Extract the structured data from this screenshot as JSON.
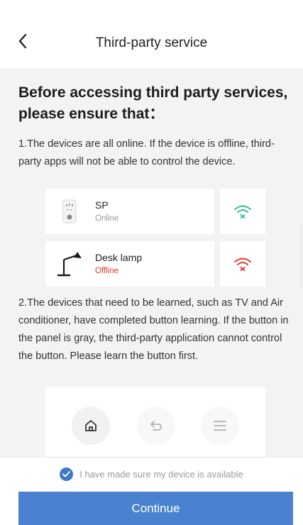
{
  "header": {
    "title": "Third-party service",
    "back_icon": "chevron-left-icon"
  },
  "content": {
    "heading": "Before accessing third party services, please ensure that：",
    "step1": "1.The devices are all online. If the device is offline, third-party apps will not be able to control the device.",
    "devices": [
      {
        "name": "SP",
        "status": "Online",
        "icon": "smart-plug-icon",
        "wifi_icon": "wifi-icon",
        "wifi_color": "#2bbf95"
      },
      {
        "name": "Desk lamp",
        "status": "Offline",
        "icon": "desk-lamp-icon",
        "wifi_icon": "wifi-off-icon",
        "wifi_color": "#e5322b"
      }
    ],
    "step2": "2.The devices that need to be learned, such as TV and Air conditioner, have completed button learning. If the button in the panel is gray, the third-party application cannot control the button. Please learn the button first.",
    "panel_buttons": [
      "home-icon",
      "return-icon",
      "menu-icon"
    ]
  },
  "footer": {
    "agree_text": "I have made sure my device is available",
    "agree_checked": true,
    "continue_label": "Continue"
  },
  "colors": {
    "accent": "#4a82cf",
    "online": "#2bbf95",
    "offline": "#e5322b",
    "background": "#f3f3f3"
  }
}
